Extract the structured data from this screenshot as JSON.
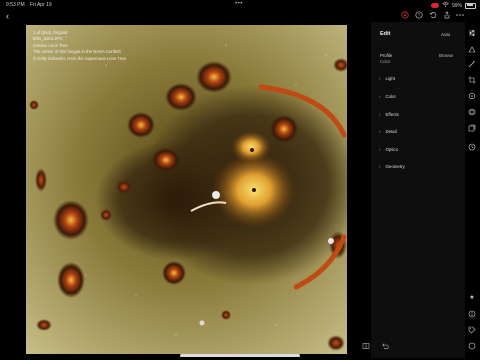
{
  "status_bar": {
    "time": "9:53 PM",
    "date": "Fri Apr 19",
    "battery": "99%"
  },
  "photo_info": {
    "line1": "1 of (554) Original",
    "line2": "IMG_8104.JPG",
    "line3": "Cosmic Lens Tree",
    "line4": "The center of this fungus in the NASA Confetti",
    "line5": "© Kelly Schaefer, Hero the Supernova Lens Tree"
  },
  "edit_panel": {
    "title": "Edit",
    "auto": "Auto",
    "profile_label": "Profile",
    "profile_value": "Color",
    "browse": "Browse",
    "sections": [
      {
        "label": "Light"
      },
      {
        "label": "Color"
      },
      {
        "label": "Effects"
      },
      {
        "label": "Detail"
      },
      {
        "label": "Optics"
      },
      {
        "label": "Geometry"
      }
    ]
  },
  "icons": {
    "chevron": "›"
  }
}
